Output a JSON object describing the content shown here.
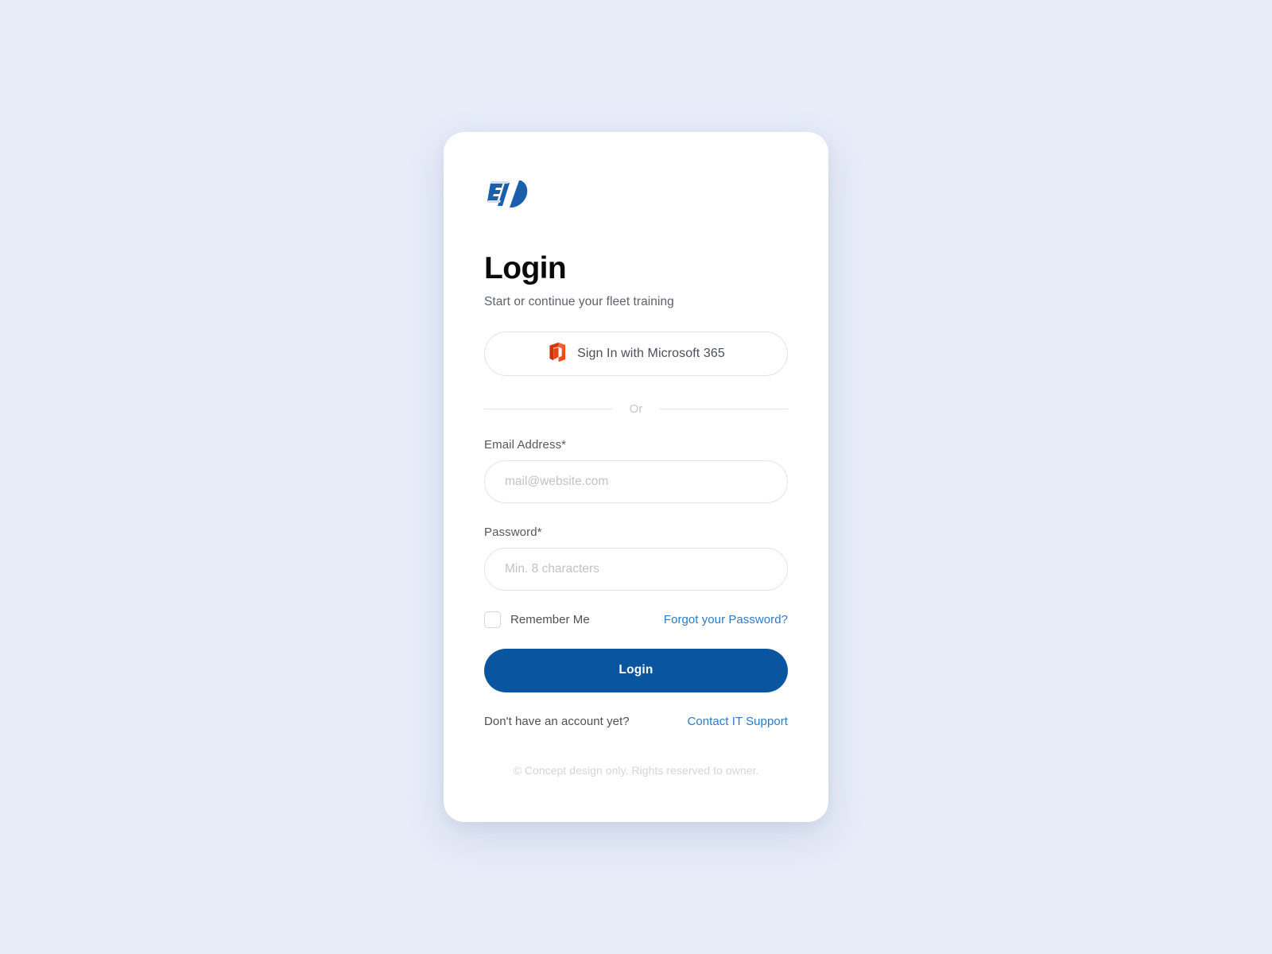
{
  "theme": {
    "page_background": "#e6ecf8",
    "card_background": "#ffffff",
    "primary": "#0a55a0",
    "link": "#2a7ac9",
    "logo_blue": "#1a5fab",
    "office_orange": "#eb3c00"
  },
  "brand": {
    "logo_name": "fleet-training-logo"
  },
  "header": {
    "title": "Login",
    "subtitle": "Start or continue your fleet training"
  },
  "sso": {
    "label": "Sign In with Microsoft 365",
    "icon": "microsoft-office-icon"
  },
  "divider": {
    "text": "Or"
  },
  "form": {
    "email": {
      "label": "Email Address*",
      "placeholder": "mail@website.com",
      "value": ""
    },
    "password": {
      "label": "Password*",
      "placeholder": "Min. 8 characters",
      "value": ""
    },
    "remember_me": {
      "label": "Remember Me",
      "checked": false
    },
    "forgot_password_label": "Forgot your Password?",
    "submit_label": "Login"
  },
  "signup": {
    "prompt": "Don't have an account yet?",
    "link_label": "Contact IT Support"
  },
  "footer": {
    "copyright": "© Concept design only. Rights reserved to owner."
  }
}
